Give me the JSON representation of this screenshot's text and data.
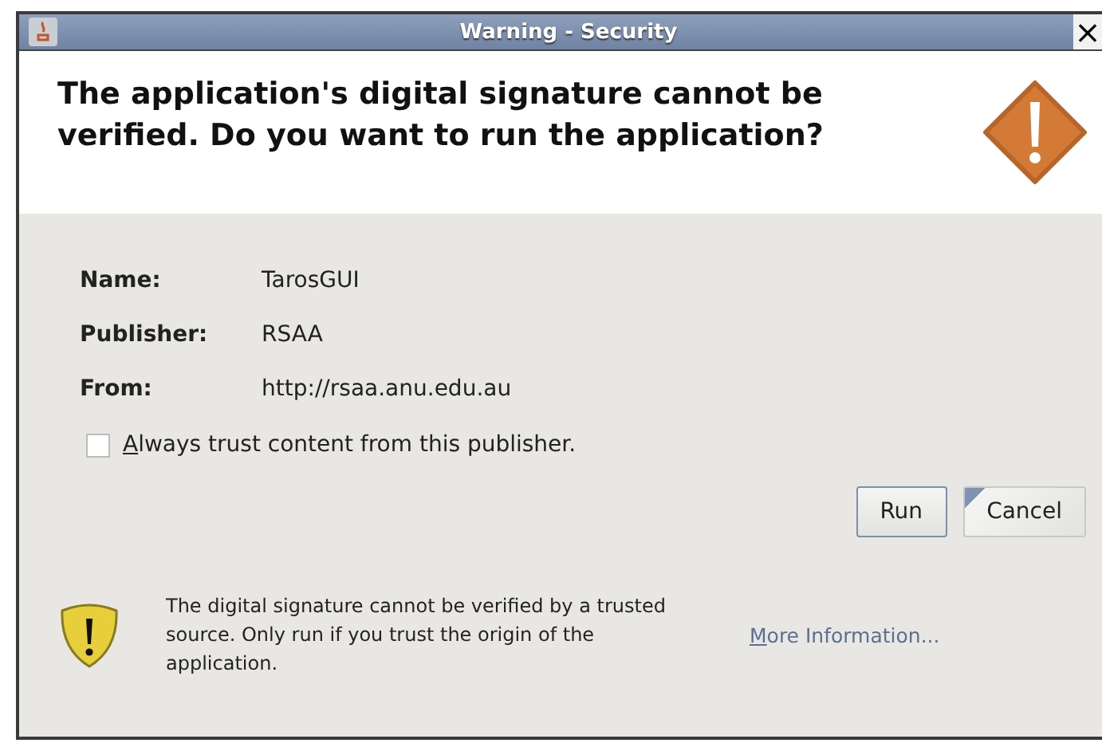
{
  "window": {
    "title": "Warning - Security",
    "close": "×"
  },
  "header": {
    "message": "The application's digital signature cannot be verified.  Do you want to run the application?"
  },
  "details": [
    {
      "label": "Name:",
      "value": "TarosGUI"
    },
    {
      "label": "Publisher:",
      "value": "RSAA"
    },
    {
      "label": "From:",
      "value": "http://rsaa.anu.edu.au"
    }
  ],
  "trust_checkbox": {
    "label": "Always trust content from this publisher.",
    "checked": false
  },
  "buttons": [
    {
      "label": "Run",
      "default": true,
      "focused": false
    },
    {
      "label": "Cancel",
      "default": false,
      "focused": true
    }
  ],
  "footer": {
    "message": "The digital signature cannot be verified by a trusted source.  Only run if you trust the origin of the application.",
    "link": "More Information..."
  }
}
